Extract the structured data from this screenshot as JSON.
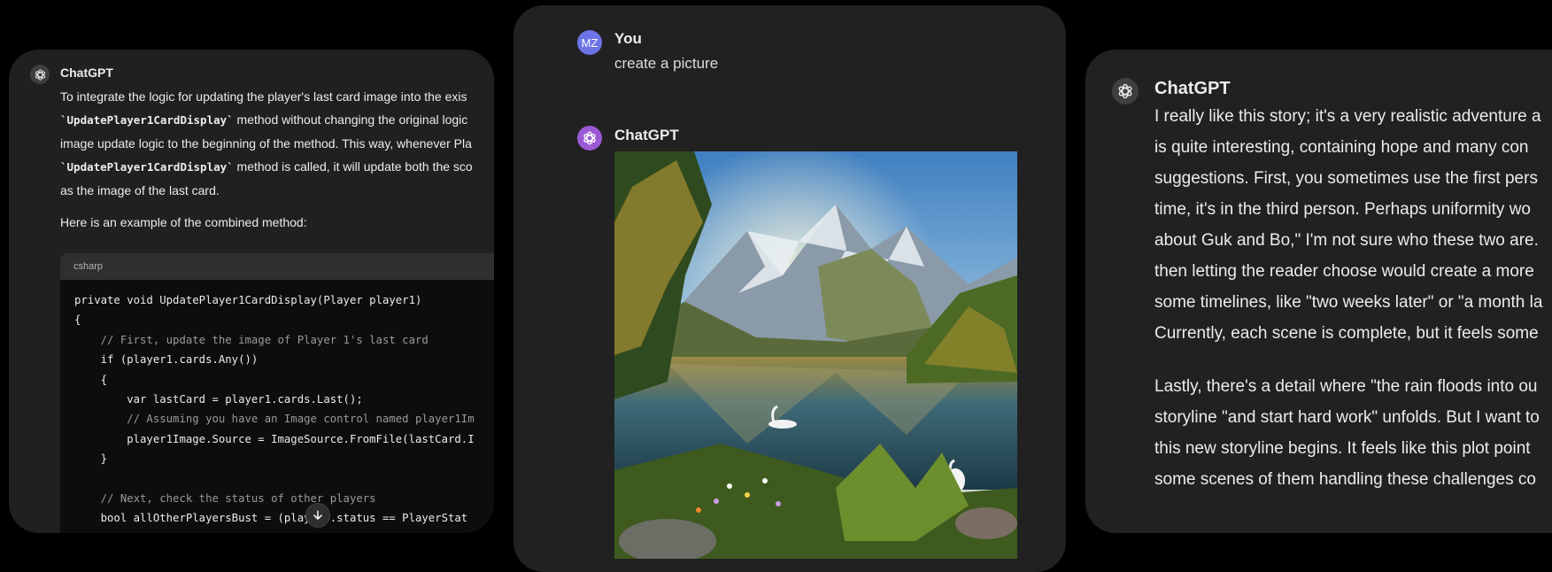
{
  "left_card": {
    "author": "ChatGPT",
    "intro_lines": [
      [
        "To integrate the logic for updating the player's last card image into the exis"
      ],
      [
        "",
        "`UpdatePlayer1CardDisplay`",
        " method without changing the original logic"
      ],
      [
        "image update logic to the beginning of the method. This way, whenever Pla"
      ],
      [
        "",
        "`UpdatePlayer1CardDisplay`",
        " method is called, it will update both the sco"
      ],
      [
        "as the image of the last card."
      ]
    ],
    "example_label": "Here is an example of the combined method:",
    "code": {
      "language": "csharp",
      "lines": [
        "private void UpdatePlayer1CardDisplay(Player player1)",
        "{",
        "    // First, update the image of Player 1's last card",
        "    if (player1.cards.Any())",
        "    {",
        "        var lastCard = player1.cards.Last();",
        "        // Assuming you have an Image control named player1Im",
        "        player1Image.Source = ImageSource.FromFile(lastCard.I",
        "    }",
        "",
        "    // Next, check the status of other players",
        "    bool allOtherPlayersBust = (player4.status == PlayerStat"
      ]
    },
    "scroll_icon": "arrow-down-icon"
  },
  "middle_card": {
    "user_initials": "MZ",
    "user_name": "You",
    "user_message": "create a picture",
    "assistant_name": "ChatGPT",
    "image_description_icon": "generated-landscape-image"
  },
  "right_card": {
    "author": "ChatGPT",
    "paragraph1": [
      "I really like this story; it's a very realistic adventure a",
      "is quite interesting, containing hope and many con",
      "suggestions. First, you sometimes use the first pers",
      "time, it's in the third person. Perhaps uniformity wo",
      "about Guk and Bo,\" I'm not sure who these two are.",
      "then letting the reader choose would create a more",
      "some timelines, like \"two weeks later\" or \"a month la",
      "Currently, each scene is complete, but it feels some"
    ],
    "paragraph2": [
      "Lastly, there's a detail where \"the rain floods into ou",
      "storyline \"and start hard work\" unfolds. But I want to",
      "this new storyline begins. It feels like this plot point",
      "some scenes of them handling these challenges co"
    ]
  },
  "colors": {
    "background": "#000000",
    "card": "#212121",
    "code_bg": "#0d0d0d",
    "user_avatar": "#6c74e6",
    "gpt_avatar_purple": "#9b59d6"
  }
}
